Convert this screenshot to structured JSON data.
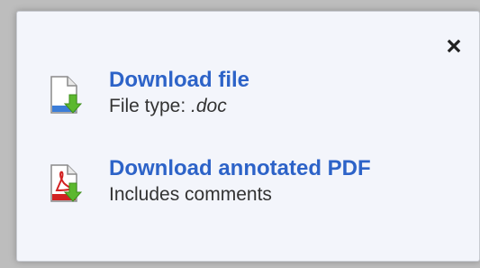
{
  "popup": {
    "close_icon": "close-icon",
    "items": [
      {
        "title": "Download file",
        "subtitle_prefix": "File type: ",
        "subtitle_ext": ".doc",
        "icon": "document-download-icon",
        "accent_color": "#3b7dd8"
      },
      {
        "title": "Download annotated PDF",
        "subtitle": "Includes comments",
        "icon": "pdf-download-icon",
        "accent_color": "#d22222"
      }
    ],
    "link_color": "#2d63c8",
    "download_arrow_color": "#5cb82e"
  }
}
